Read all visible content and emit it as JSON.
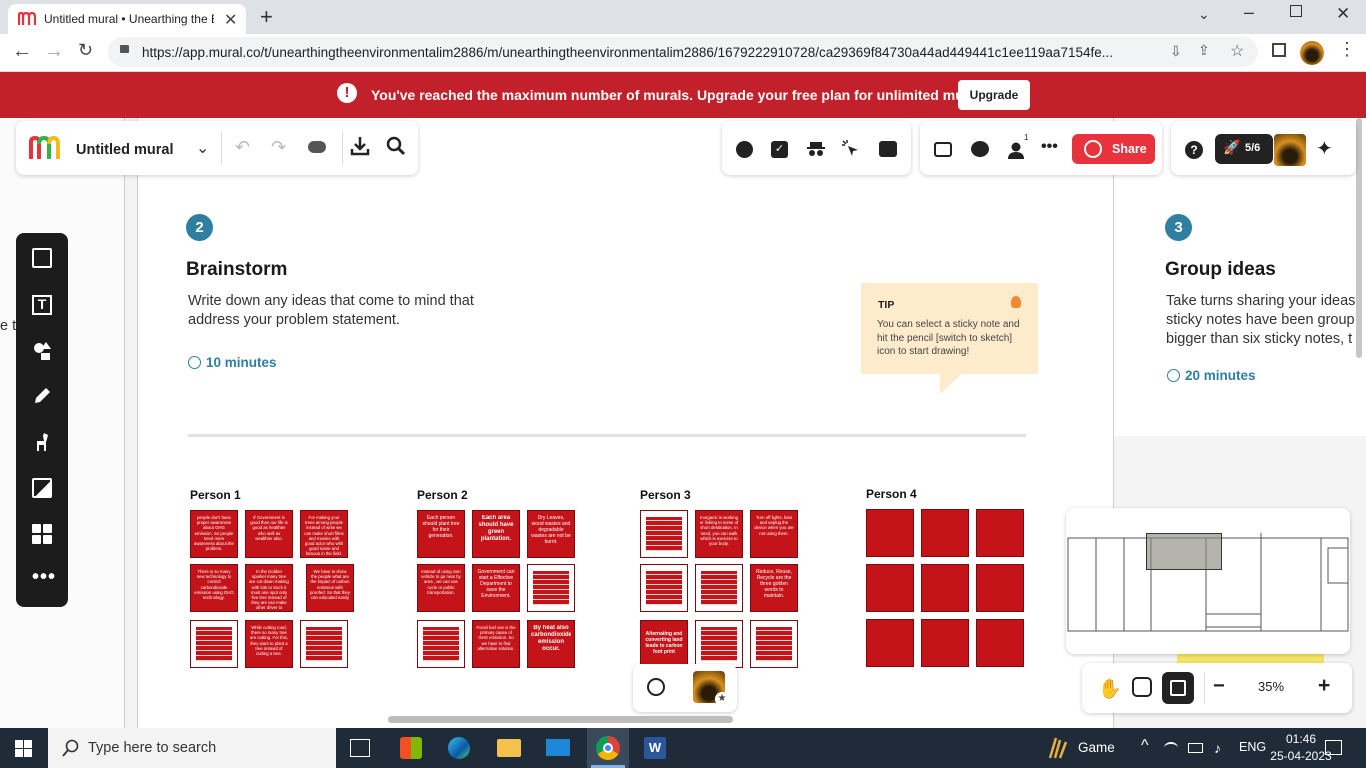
{
  "browser": {
    "tab_title": "Untitled mural • Unearthing the E",
    "url": "https://app.mural.co/t/unearthingtheenvironmentalim2886/m/unearthingtheenvironmentalim2886/1679222910728/ca29369f84730a44ad449441c1ee119aa7154fe..."
  },
  "banner": {
    "message": "You've reached the maximum number of murals. Upgrade your free plan for unlimited murals.",
    "upgrade_label": "Upgrade"
  },
  "mural": {
    "title": "Untitled mural",
    "share_label": "Share",
    "rocket_count": "5/6",
    "collaborators_badge": "1",
    "zoom": "35%"
  },
  "sections": {
    "brainstorm": {
      "step": "2",
      "title": "Brainstorm",
      "desc": "Write down any ideas that come to mind that address your problem statement.",
      "timer": "10 minutes"
    },
    "group": {
      "step": "3",
      "title": "Group ideas",
      "desc": "Take turns sharing your ideas sticky notes have been group bigger than six sticky notes, t",
      "timer": "20 minutes"
    },
    "tip": {
      "label": "TIP",
      "text": "You can select a sticky note and hit the pencil [switch to sketch] icon to start drawing!"
    },
    "left_partial": "e th"
  },
  "persons": [
    {
      "label": "Person 1"
    },
    {
      "label": "Person 2"
    },
    {
      "label": "Person 3"
    },
    {
      "label": "Person 4"
    }
  ],
  "notes": {
    "p1": [
      "people don't have proper awareness about GHG emission. So people need more awareness about the problem.",
      "If Government is good then our life is good as healthier who well as wealthier also.",
      "For making your trees among people instead of write we can make short films and movies with good actor who with good name and famous in the field.",
      "In the Golden sparkel many tree are cut down making with lots to Such it must one spot only five tree instead of they are can make other driver to replacing tree.",
      "We have to show the people what are the impact of carbon emission with proofed. So that they can educated easily",
      "There is so many new technology to control carbondioxide emission using GHG technology.",
      "",
      "While cutting road, there so many tree are cutting. For this, they want to plant a tree instead of cutting a tree.",
      ""
    ],
    "p2": [
      "Each person should plant tree for their generation.",
      "Each area should have green plantation.",
      "Dry Leaves, wood wastes and degradable wastes are not be burnt.",
      "Instead of using own vehicle to go near by area , we can use cycle or public transportation.",
      "Government can start a Effective Department to save the Environment.",
      "",
      "",
      "Fossil fuel use is the primary cause of GHG emission. So we have to find alternative solution.",
      "By heat also carbondioxide emission occur."
    ],
    "p3": [
      "",
      "Inorganic is working or linking to some of short destination. In need, you can walk which is exercise to your body.",
      "Turn off lights, fans and unplug the device when you are not using them.",
      "",
      "Reduce, Reuse, Recycle are the three golden words to maintain.",
      "",
      "Alternating and converting land leads to carbon foot print",
      "",
      ""
    ]
  },
  "toolbar_icons": {
    "left": [
      "sticky-note-icon",
      "text-icon",
      "shapes-icon",
      "pencil-icon",
      "llama-icon",
      "image-icon",
      "templates-icon",
      "more-icon"
    ],
    "top_mid": [
      "timer-icon",
      "vote-icon",
      "private-mode-icon",
      "laser-pointer-icon",
      "toolbox-icon"
    ],
    "top_right": [
      "outline-icon",
      "comments-icon",
      "collaborators-icon",
      "more-icon"
    ]
  },
  "taskbar": {
    "search_placeholder": "Type here to search",
    "weather": "Game",
    "language": "ENG",
    "time": "01:46",
    "date": "25-04-2023"
  }
}
